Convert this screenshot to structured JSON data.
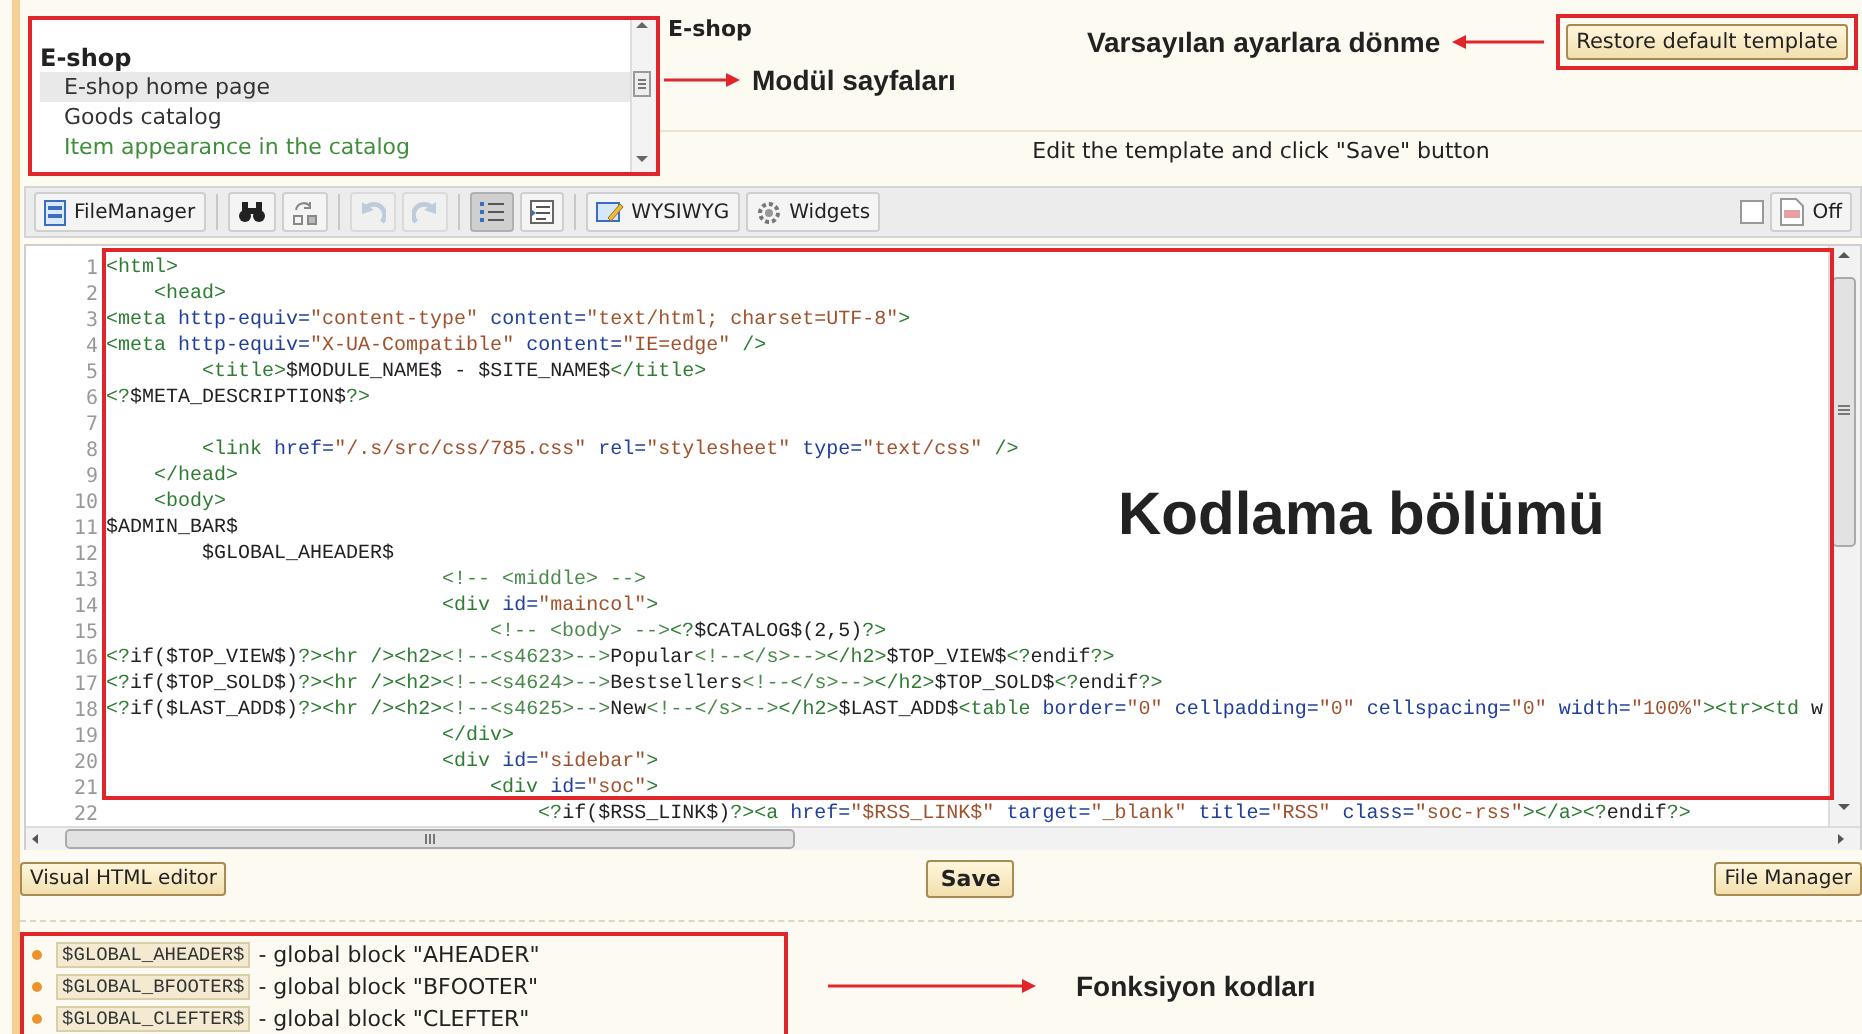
{
  "module_list": {
    "group": "E-shop",
    "items": [
      {
        "label": "E-shop home page",
        "selected": true,
        "color": "#333333"
      },
      {
        "label": "Goods catalog",
        "selected": false,
        "color": "#333333"
      },
      {
        "label": "Item appearance in the catalog",
        "selected": false,
        "color": "#3f8f3a"
      }
    ]
  },
  "module_title": "E-shop",
  "hint": "Edit the template and click \"Save\" button",
  "restore_button": "Restore default template",
  "annotations": {
    "restore": "Varsayılan ayarlara dönme",
    "pages": "Modül sayfaları",
    "code": "Kodlama bölümü",
    "functions": "Fonksiyon kodları"
  },
  "toolbar": {
    "file_manager": "FileManager",
    "undo": {
      "disabled": true
    },
    "redo": {
      "disabled": true
    },
    "line_numbers": {
      "pressed": true
    },
    "wysiwyg": "WYSIWYG",
    "widgets": "Widgets",
    "highlight": {
      "checked": false
    },
    "toggle": "Off"
  },
  "editor": {
    "lines": [
      {
        "number": "1",
        "text": "<html>"
      },
      {
        "number": "2",
        "text": "    <head>"
      },
      {
        "number": "3",
        "text": "<meta http-equiv=\"content-type\" content=\"text/html; charset=UTF-8\">"
      },
      {
        "number": "4",
        "text": "<meta http-equiv=\"X-UA-Compatible\" content=\"IE=edge\" />"
      },
      {
        "number": "5",
        "text": "        <title>$MODULE_NAME$ - $SITE_NAME$</title>"
      },
      {
        "number": "6",
        "text": "<?$META_DESCRIPTION$?>"
      },
      {
        "number": "7"
      },
      {
        "number": "8",
        "text": "        <link href=\"/.s/src/css/785.css\" rel=\"stylesheet\" type=\"text/css\" />"
      },
      {
        "number": "9",
        "text": "    </head>"
      },
      {
        "number": "10",
        "text": "    <body>"
      },
      {
        "number": "11",
        "text": "$ADMIN_BAR$"
      },
      {
        "number": "12",
        "text": "        $GLOBAL_AHEADER$"
      },
      {
        "number": "13",
        "text": "                            <!-- <middle> -->"
      },
      {
        "number": "14",
        "text": "                            <div id=\"maincol\">"
      },
      {
        "number": "15",
        "text": "                                <!-- <body> --><?$CATALOG$(2,5)?>"
      },
      {
        "number": "16",
        "text": "<?if($TOP_VIEW$)?><hr /><h2><!--<s4623>-->Popular<!--</s>--></h2>$TOP_VIEW$<?endif?>"
      },
      {
        "number": "17",
        "text": "<?if($TOP_SOLD$)?><hr /><h2><!--<s4624>-->Bestsellers<!--</s>--></h2>$TOP_SOLD$<?endif?>"
      },
      {
        "number": "18",
        "text": "<?if($LAST_ADD$)?><hr /><h2><!--<s4625>-->New<!--</s>--></h2>$LAST_ADD$<table border=\"0\" cellpadding=\"0\" cellspacing=\"0\" width=\"100%\"><tr><td w"
      },
      {
        "number": "19",
        "text": "                            </div>"
      },
      {
        "number": "20",
        "text": "                            <div id=\"sidebar\">"
      },
      {
        "number": "21",
        "text": "                                <div id=\"soc\">"
      },
      {
        "number": "22",
        "text": "                                    <?if($RSS_LINK$)?><a href=\"$RSS_LINK$\" target=\"_blank\" title=\"RSS\" class=\"soc-rss\"></a><?endif?>"
      }
    ]
  },
  "actions": {
    "visual_editor": "Visual HTML editor",
    "save": "Save",
    "file_manager": "File Manager"
  },
  "blocks": [
    {
      "code": "$GLOBAL_AHEADER$",
      "description": "- global block \"AHEADER\""
    },
    {
      "code": "$GLOBAL_BFOOTER$",
      "description": "- global block \"BFOOTER\""
    },
    {
      "code": "$GLOBAL_CLEFTER$",
      "description": "- global block \"CLEFTER\""
    }
  ]
}
